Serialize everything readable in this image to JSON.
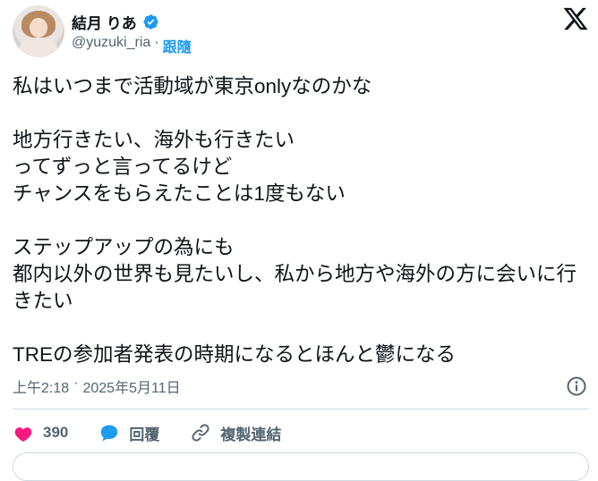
{
  "author": {
    "display_name": "結月 りあ",
    "handle": "@yuzuki_ria",
    "separator": "·",
    "follow_label": "跟隨"
  },
  "tweet": {
    "text": "私はいつまで活動域が東京onlyなのかな\n\n地方行きたい、海外も行きたい\nってずっと言ってるけど\nチャンスをもらえたことは1度もない\n\nステップアップの為にも\n都内以外の世界も見たいし、私から地方や海外の方に会いに行きたい\n\nTREの参加者発表の時期になるとほんと鬱になる",
    "time": "上午2:18",
    "dot": "·",
    "date": "2025年5月11日"
  },
  "actions": {
    "like_count": "390",
    "reply_label": "回覆",
    "copy_link_label": "複製連結"
  },
  "colors": {
    "like": "#f91880",
    "reply": "#1d9bf0",
    "verified": "#1d9bf0",
    "follow": "#1d9bf0"
  },
  "icons": [
    "verified-badge-icon",
    "x-logo-icon",
    "info-icon",
    "heart-icon",
    "reply-bubble-icon",
    "link-icon"
  ]
}
